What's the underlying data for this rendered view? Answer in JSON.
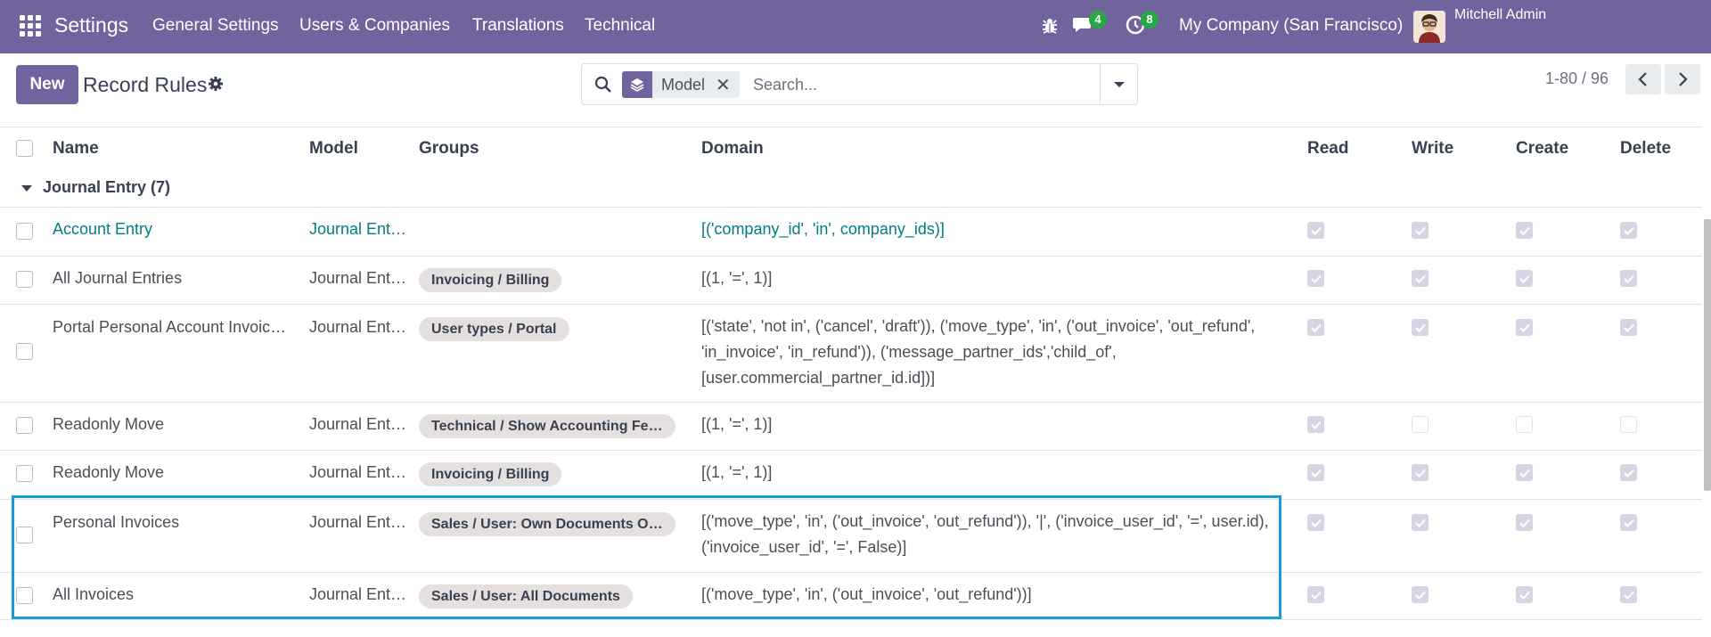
{
  "navbar": {
    "app_name": "Settings",
    "menu": [
      "General Settings",
      "Users & Companies",
      "Translations",
      "Technical"
    ],
    "messages_count": "4",
    "activities_count": "8",
    "company": "My Company (San Francisco)",
    "user": "Mitchell Admin",
    "color": "#71639e"
  },
  "control_panel": {
    "new_label": "New",
    "title": "Record Rules",
    "facet_label": "Model",
    "search_placeholder": "Search...",
    "pager": "1-80 / 96"
  },
  "list": {
    "columns": [
      "Name",
      "Model",
      "Groups",
      "Domain",
      "Read",
      "Write",
      "Create",
      "Delete"
    ],
    "group_label": "Journal Entry (7)",
    "rows": [
      {
        "name": "Account Entry",
        "model": "Journal Ent…",
        "group": "",
        "domain": "[('company_id', 'in', company_ids)]",
        "read": true,
        "write": true,
        "create": true,
        "delete": true
      },
      {
        "name": "All Journal Entries",
        "model": "Journal Ent…",
        "group": "Invoicing / Billing",
        "domain": "[(1, '=', 1)]",
        "read": true,
        "write": true,
        "create": true,
        "delete": true
      },
      {
        "name": "Portal Personal Account Invoic…",
        "model": "Journal Ent…",
        "group": "User types / Portal",
        "domain": "[('state', 'not in', ('cancel', 'draft')), ('move_type', 'in', ('out_invoice', 'out_refund', 'in_invoice', 'in_refund')), ('message_partner_ids','child_of', [user.commercial_partner_id.id])]",
        "read": true,
        "write": true,
        "create": true,
        "delete": true
      },
      {
        "name": "Readonly Move",
        "model": "Journal Ent…",
        "group": "Technical / Show Accounting Fe…",
        "domain": "[(1, '=', 1)]",
        "read": true,
        "write": false,
        "create": false,
        "delete": false
      },
      {
        "name": "Readonly Move",
        "model": "Journal Ent…",
        "group": "Invoicing / Billing",
        "domain": "[(1, '=', 1)]",
        "read": true,
        "write": true,
        "create": true,
        "delete": true
      },
      {
        "name": "Personal Invoices",
        "model": "Journal Ent…",
        "group": "Sales / User: Own Documents O…",
        "domain": "[('move_type', 'in', ('out_invoice', 'out_refund')), '|', ('invoice_user_id', '=', user.id), ('invoice_user_id', '=', False)]",
        "read": true,
        "write": true,
        "create": true,
        "delete": true
      },
      {
        "name": "All Invoices",
        "model": "Journal Ent…",
        "group": "Sales / User: All Documents",
        "domain": "[('move_type', 'in', ('out_invoice', 'out_refund'))]",
        "read": true,
        "write": true,
        "create": true,
        "delete": true
      }
    ]
  }
}
